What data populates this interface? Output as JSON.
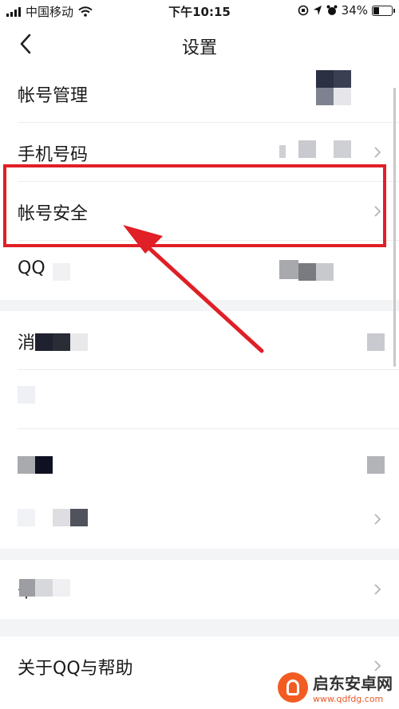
{
  "status_bar": {
    "carrier": "中国移动",
    "time": "下午10:15",
    "battery_percent": "34%",
    "battery_level": 0.34
  },
  "navbar": {
    "title": "设置"
  },
  "rows": [
    {
      "label": "帐号管理"
    },
    {
      "label": "手机号码"
    },
    {
      "label": "帐号安全"
    },
    {
      "label": "QQ"
    },
    {
      "label": "消"
    },
    {
      "label": ""
    },
    {
      "label": ""
    },
    {
      "label": ""
    },
    {
      "label": "个"
    },
    {
      "label": "关于QQ与帮助"
    }
  ],
  "watermark": {
    "name": "启东安卓网",
    "url": "www.qdfdg.com"
  },
  "colors": {
    "highlight": "#e01f26",
    "background": "#ffffff",
    "section_gap": "#f3f4f6"
  }
}
